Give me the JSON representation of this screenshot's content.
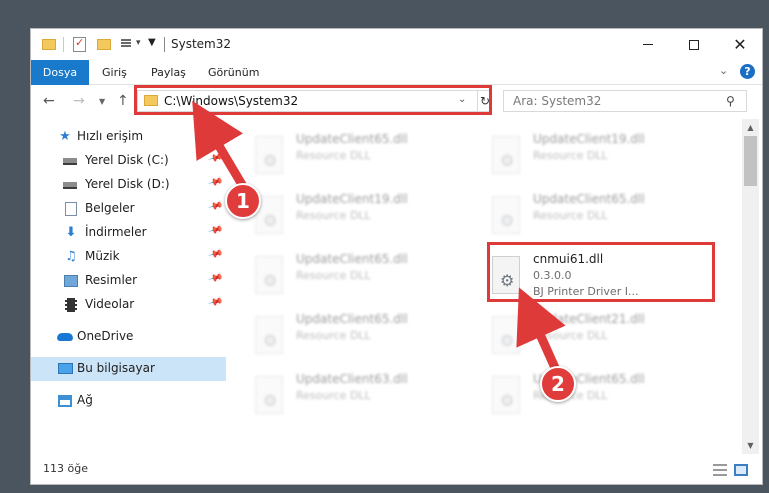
{
  "window": {
    "title": "System32"
  },
  "ribbon": {
    "tabs": [
      "Dosya",
      "Giriş",
      "Paylaş",
      "Görünüm"
    ]
  },
  "address_bar": {
    "path": "C:\\Windows\\System32"
  },
  "search": {
    "placeholder": "Ara: System32"
  },
  "nav_pane": {
    "items": [
      {
        "label": "Hızlı erişim",
        "icon": "star-icon"
      },
      {
        "label": "Yerel Disk (C:)",
        "icon": "drive-icon",
        "pinned": true
      },
      {
        "label": "Yerel Disk (D:)",
        "icon": "drive-icon",
        "pinned": true
      },
      {
        "label": "Belgeler",
        "icon": "documents-icon",
        "pinned": true
      },
      {
        "label": "İndirmeler",
        "icon": "download-icon",
        "pinned": true
      },
      {
        "label": "Müzik",
        "icon": "music-icon",
        "pinned": true
      },
      {
        "label": "Resimler",
        "icon": "pictures-icon",
        "pinned": true
      },
      {
        "label": "Videolar",
        "icon": "videos-icon",
        "pinned": true
      },
      {
        "label": "OneDrive",
        "icon": "onedrive-icon"
      },
      {
        "label": "Bu bilgisayar",
        "icon": "this-pc-icon",
        "selected": true
      },
      {
        "label": "Ağ",
        "icon": "network-icon"
      }
    ]
  },
  "files": [
    {
      "name": "UpdateClient65.dll",
      "desc": "Resource DLL"
    },
    {
      "name": "UpdateClient19.dll",
      "desc": "Resource DLL"
    },
    {
      "name": "UpdateClient19.dll",
      "desc": "Resource DLL"
    },
    {
      "name": "UpdateClient65.dll",
      "desc": "Resource DLL"
    },
    {
      "name": "UpdateClient65.dll",
      "desc": "Resource DLL"
    },
    {
      "name": "cnmui61.dll",
      "version": "0.3.0.0",
      "desc": "BJ Printer Driver I..."
    },
    {
      "name": "UpdateClient65.dll",
      "desc": "Resource DLL"
    },
    {
      "name": "UpdateClient21.dll",
      "desc": "Resource DLL"
    },
    {
      "name": "UpdateClient63.dll",
      "desc": "Resource DLL"
    },
    {
      "name": "UpdateClient65.dll",
      "desc": "Resource DLL"
    }
  ],
  "status": {
    "item_count": "113 öğe"
  },
  "annotations": {
    "step1": "1",
    "step2": "2",
    "color": "#df3a3a"
  }
}
